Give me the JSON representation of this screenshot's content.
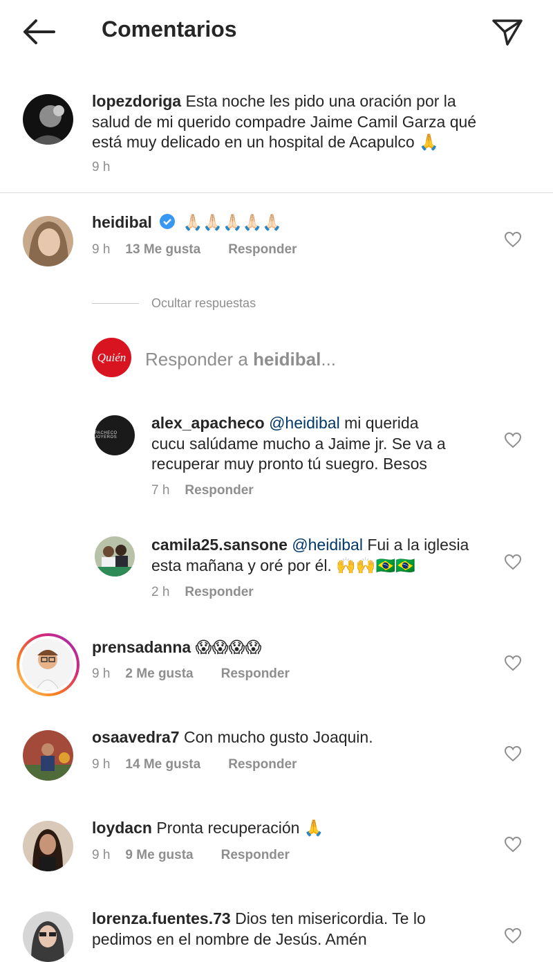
{
  "header": {
    "title": "Comentarios",
    "back_icon": "arrow-left-icon",
    "share_icon": "paper-plane-icon"
  },
  "caption": {
    "username": "lopezdoriga",
    "text_lines": [
      "Esta noche les pido una oración por la",
      "salud de mi querido compadre Jaime Camil Garza qué",
      "está muy delicado en un hospital de Acapulco 🙏"
    ],
    "time": "9 h"
  },
  "comments": [
    {
      "username": "heidibal",
      "verified": true,
      "text": "🙏🏻🙏🏻🙏🏻🙏🏻🙏🏻",
      "time": "9 h",
      "likes": "13 Me gusta",
      "reply": "Responder"
    },
    {
      "username": "prensadanna",
      "text": "😱😱😱😱",
      "time": "9 h",
      "likes": "2 Me gusta",
      "reply": "Responder"
    },
    {
      "username": "osaavedra7",
      "text": "Con mucho gusto Joaquin.",
      "time": "9 h",
      "likes": "14 Me gusta",
      "reply": "Responder"
    },
    {
      "username": "loydacn",
      "text": "Pronta recuperación 🙏",
      "time": "9 h",
      "likes": "9 Me gusta",
      "reply": "Responder"
    },
    {
      "username": "lorenza.fuentes.73",
      "text_lines": [
        "Dios ten misericordia. Te lo",
        "pedimos en el nombre de Jesús. Amén"
      ]
    }
  ],
  "hide_replies": "Ocultar respuestas",
  "reply_box": {
    "prefix": "Responder a ",
    "target": "heidibal",
    "suffix": "...",
    "avatar_text": "Quién",
    "brand_color": "#d7141f"
  },
  "replies": [
    {
      "username": "alex_apacheco",
      "mention": "@heidibal",
      "text_lines": [
        "mi querida",
        "cucu salúdame mucho a Jaime jr. Se va a",
        "recuperar muy pronto tú suegro. Besos"
      ],
      "time": "7 h",
      "reply": "Responder",
      "avatar_text": "PACHECO JOYEROS"
    },
    {
      "username": "camila25.sansone",
      "mention": "@heidibal",
      "text_lines": [
        "Fui a la iglesia",
        "esta mañana y oré por él. 🙌🙌🇧🇷🇧🇷"
      ],
      "time": "2 h",
      "reply": "Responder"
    }
  ]
}
